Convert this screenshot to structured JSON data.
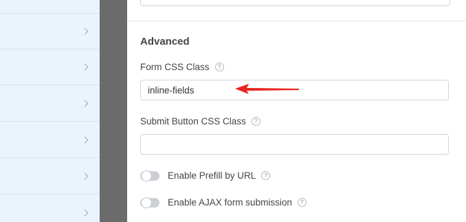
{
  "sidebar": {
    "items": [
      {
        "chevron": "chevron-right-icon"
      },
      {
        "chevron": "chevron-right-icon"
      },
      {
        "chevron": "chevron-right-icon"
      },
      {
        "chevron": "chevron-right-icon"
      },
      {
        "chevron": "chevron-right-icon"
      },
      {
        "chevron": "chevron-right-icon"
      },
      {
        "chevron": "chevron-right-icon"
      }
    ]
  },
  "top_field": {
    "value_fragment": "…"
  },
  "advanced": {
    "title": "Advanced",
    "form_css_class": {
      "label": "Form CSS Class",
      "value": "inline-fields",
      "help_icon": "question-circle-icon"
    },
    "submit_button_css_class": {
      "label": "Submit Button CSS Class",
      "value": "",
      "help_icon": "question-circle-icon"
    },
    "toggles": [
      {
        "label": "Enable Prefill by URL",
        "enabled": false,
        "help_icon": "question-circle-icon"
      },
      {
        "label": "Enable AJAX form submission",
        "enabled": false,
        "help_icon": "question-circle-icon"
      }
    ]
  },
  "annotation": {
    "arrow_color": "#e8251d"
  },
  "colors": {
    "sidebar_bg": "#ebf3fc",
    "divider_bg": "#6b6b6b",
    "text": "#444444",
    "toggle_off": "#ccd0d4"
  }
}
